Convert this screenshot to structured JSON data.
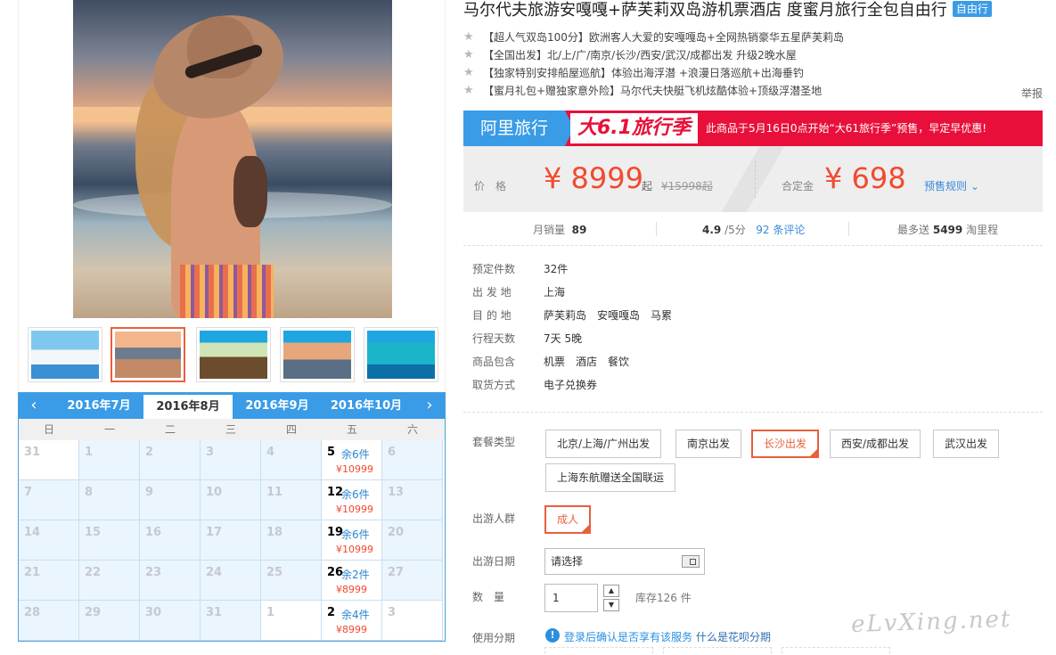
{
  "title": "马尔代夫旅游安嘎嘎+萨芙莉双岛游机票酒店 度蜜月旅行全包自由行",
  "title_tag": "自由行",
  "features": [
    "【超人气双岛100分】欧洲客人大爱的安嘎嘎岛+全网热销豪华五星萨芙莉岛",
    "【全国出发】北/上/广/南京/长沙/西安/武汉/成都出发 升级2晚水屋",
    "【独家特别安排船屋巡航】体验出海浮潜 +浪漫日落巡航+出海垂钓",
    "【蜜月礼包+赠独家意外险】马尔代夫快艇飞机炫酷体验+顶级浮潜圣地"
  ],
  "report_label": "举报",
  "promo": {
    "brand": "阿里旅行",
    "festival": "大6.1旅行季",
    "message": "此商品于5月16日0点开始“大61旅行季”预售，早定早优惠!"
  },
  "price": {
    "label": "价　格",
    "currency": "¥",
    "value": "8999",
    "suffix": "起",
    "original": "¥15998起",
    "deposit_label": "合定金",
    "deposit_value": "698",
    "rule_link": "预售规则"
  },
  "stats": {
    "sales_label": "月销量",
    "sales": "89",
    "rating": "4.9",
    "rating_suffix": "/5分",
    "reviews_count": "92",
    "reviews_label": "条评论",
    "points_label": "最多送",
    "points": "5499",
    "points_suffix": "淘里程"
  },
  "details": [
    {
      "label": "预定件数",
      "value": [
        "32件"
      ]
    },
    {
      "label": "出 发 地",
      "value": [
        "上海"
      ]
    },
    {
      "label": "目 的 地",
      "value": [
        "萨芙莉岛",
        "安嘎嘎岛",
        "马累"
      ]
    },
    {
      "label": "行程天数",
      "value": [
        "7天 5晚"
      ]
    },
    {
      "label": "商品包含",
      "value": [
        "机票",
        "酒店",
        "餐饮"
      ]
    },
    {
      "label": "取货方式",
      "value": [
        "电子兑换券"
      ]
    }
  ],
  "package": {
    "label": "套餐类型",
    "options": [
      "北京/上海/广州出发",
      "南京出发",
      "长沙出发",
      "西安/成都出发",
      "武汉出发",
      "上海东航赠送全国联运"
    ],
    "selected": "长沙出发"
  },
  "travelers": {
    "label": "出游人群",
    "options": [
      "成人"
    ],
    "selected": "成人"
  },
  "date": {
    "label": "出游日期",
    "placeholder": "请选择"
  },
  "quantity": {
    "label": "数　量",
    "value": "1",
    "stock": "库存126 件"
  },
  "installment": {
    "label": "使用分期",
    "text": "登录后确认是否享有该服务",
    "link": "什么是花呗分期"
  },
  "calendar": {
    "months": [
      "2016年7月",
      "2016年8月",
      "2016年9月",
      "2016年10月"
    ],
    "active_month": "2016年8月",
    "weekdays": [
      "日",
      "一",
      "二",
      "三",
      "四",
      "五",
      "六"
    ],
    "days": [
      {
        "d": "31",
        "blank": true
      },
      {
        "d": "1"
      },
      {
        "d": "2"
      },
      {
        "d": "3"
      },
      {
        "d": "4"
      },
      {
        "d": "5",
        "stock": "余6件",
        "price": "¥10999"
      },
      {
        "d": "6"
      },
      {
        "d": "7"
      },
      {
        "d": "8"
      },
      {
        "d": "9"
      },
      {
        "d": "10"
      },
      {
        "d": "11"
      },
      {
        "d": "12",
        "stock": "余6件",
        "price": "¥10999"
      },
      {
        "d": "13"
      },
      {
        "d": "14"
      },
      {
        "d": "15"
      },
      {
        "d": "16"
      },
      {
        "d": "17"
      },
      {
        "d": "18"
      },
      {
        "d": "19",
        "stock": "余6件",
        "price": "¥10999"
      },
      {
        "d": "20"
      },
      {
        "d": "21"
      },
      {
        "d": "22"
      },
      {
        "d": "23"
      },
      {
        "d": "24"
      },
      {
        "d": "25"
      },
      {
        "d": "26",
        "stock": "余2件",
        "price": "¥8999"
      },
      {
        "d": "27"
      },
      {
        "d": "28"
      },
      {
        "d": "29"
      },
      {
        "d": "30"
      },
      {
        "d": "31"
      },
      {
        "d": "1",
        "blank": true
      },
      {
        "d": "2",
        "stock": "余4件",
        "price": "¥8999",
        "blank": true
      },
      {
        "d": "3",
        "blank": true
      }
    ]
  },
  "watermark": "eLvXing.net",
  "colors": {
    "accent_blue": "#3a9be6",
    "price_red": "#f24a30",
    "promo_red": "#e8103a",
    "selected_border": "#e85f3c"
  }
}
